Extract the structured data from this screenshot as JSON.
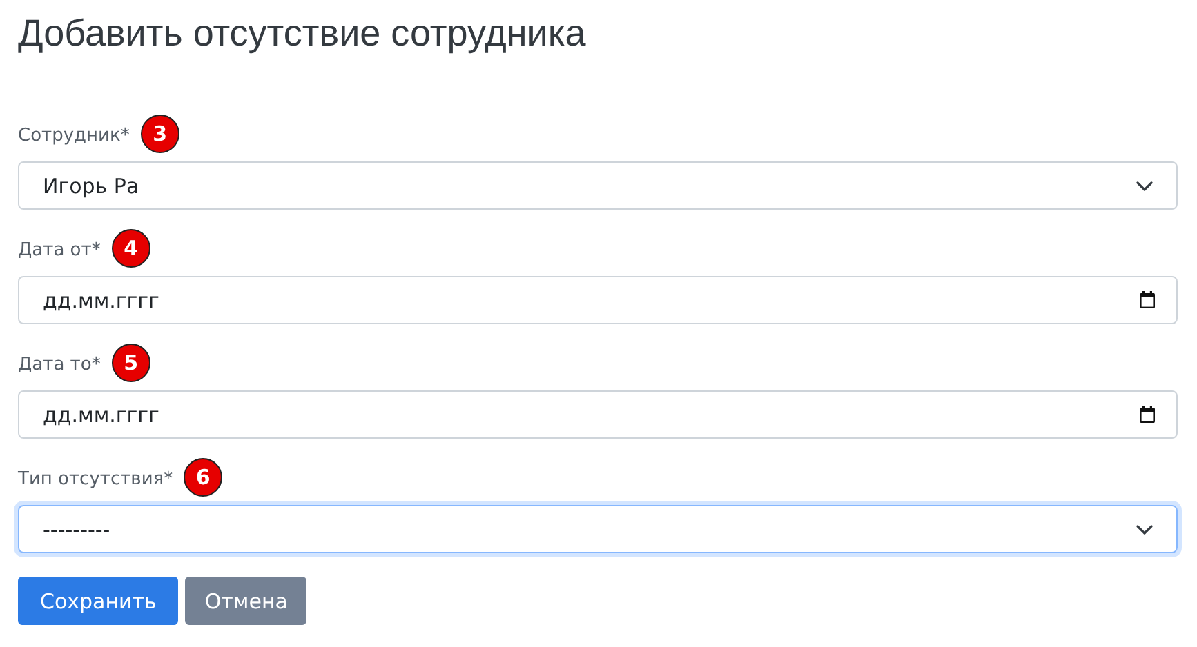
{
  "title": "Добавить отсутствие сотрудника",
  "fields": [
    {
      "kind": "select",
      "label": "Сотрудник*",
      "value": "Игорь Ра",
      "badge": "3",
      "focused": false
    },
    {
      "kind": "date",
      "label": "Дата от*",
      "value": "дд.мм.гггг",
      "badge": "4",
      "focused": false
    },
    {
      "kind": "date",
      "label": "Дата то*",
      "value": "дд.мм.гггг",
      "badge": "5",
      "focused": false
    },
    {
      "kind": "select",
      "label": "Тип отсутствия*",
      "value": "---------",
      "badge": "6",
      "focused": true
    }
  ],
  "buttons": [
    {
      "kind": "primary",
      "label": "Сохранить"
    },
    {
      "kind": "secondary",
      "label": "Отмена"
    }
  ]
}
